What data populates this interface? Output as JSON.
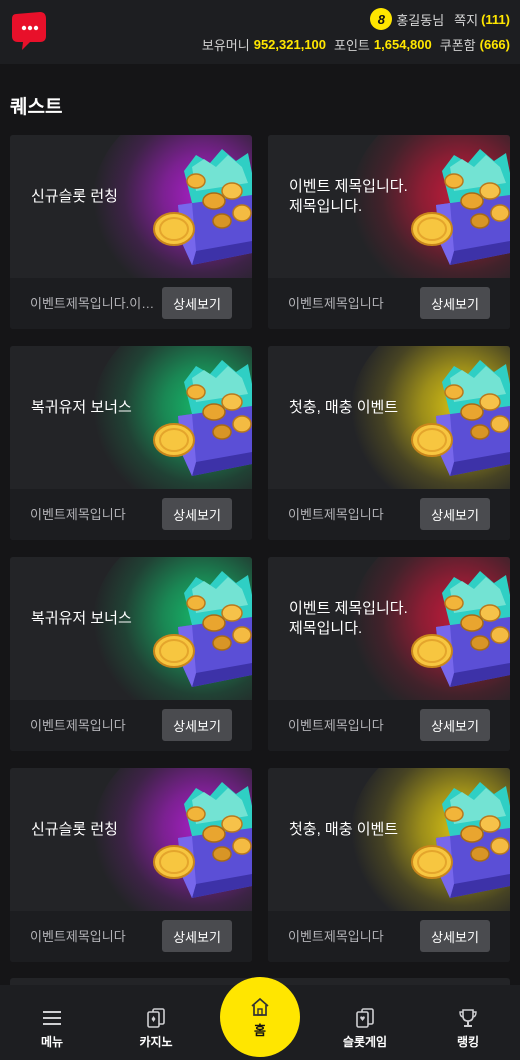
{
  "header": {
    "level": "8",
    "username": "홍길동님",
    "messages_label": "쪽지",
    "messages_count": "(111)",
    "money_label": "보유머니",
    "money_value": "952,321,100",
    "point_label": "포인트",
    "point_value": "1,654,800",
    "coupon_label": "쿠폰함",
    "coupon_count": "(666)"
  },
  "section_title": "퀘스트",
  "quests": [
    {
      "title": "신규슬롯 런칭",
      "subtitle": "이벤트제목입니다.이벤트제목입니다.",
      "button": "상세보기",
      "glow": "#a81fc7"
    },
    {
      "title": "이벤트 제목입니다.\n제목입니다.",
      "subtitle": "이벤트제목입니다",
      "button": "상세보기",
      "glow": "#c01a3a"
    },
    {
      "title": "복귀유저 보너스",
      "subtitle": "이벤트제목입니다",
      "button": "상세보기",
      "glow": "#16b86a"
    },
    {
      "title": "첫충, 매충 이벤트",
      "subtitle": "이벤트제목입니다",
      "button": "상세보기",
      "glow": "#d8c214"
    },
    {
      "title": "복귀유저 보너스",
      "subtitle": "이벤트제목입니다",
      "button": "상세보기",
      "glow": "#16b86a"
    },
    {
      "title": "이벤트 제목입니다.\n제목입니다.",
      "subtitle": "이벤트제목입니다",
      "button": "상세보기",
      "glow": "#c01a3a"
    },
    {
      "title": "신규슬롯 런칭",
      "subtitle": "이벤트제목입니다",
      "button": "상세보기",
      "glow": "#a81fc7"
    },
    {
      "title": "첫충, 매충 이벤트",
      "subtitle": "이벤트제목입니다",
      "button": "상세보기",
      "glow": "#d8c214"
    }
  ],
  "nav": {
    "menu": "메뉴",
    "casino": "카지노",
    "home": "홈",
    "slot": "슬롯게임",
    "ranking": "랭킹"
  },
  "colors": {
    "accent": "#ffe600",
    "background": "#151517",
    "card": "#232427",
    "logo": "#e8102a"
  },
  "icons": {
    "logo": "chat-bubble-logo",
    "chest": "treasure-chest-coins",
    "menu": "hamburger-icon",
    "casino": "cards-icon",
    "home": "house-icon",
    "slot": "slot-cards-icon",
    "ranking": "trophy-icon"
  }
}
